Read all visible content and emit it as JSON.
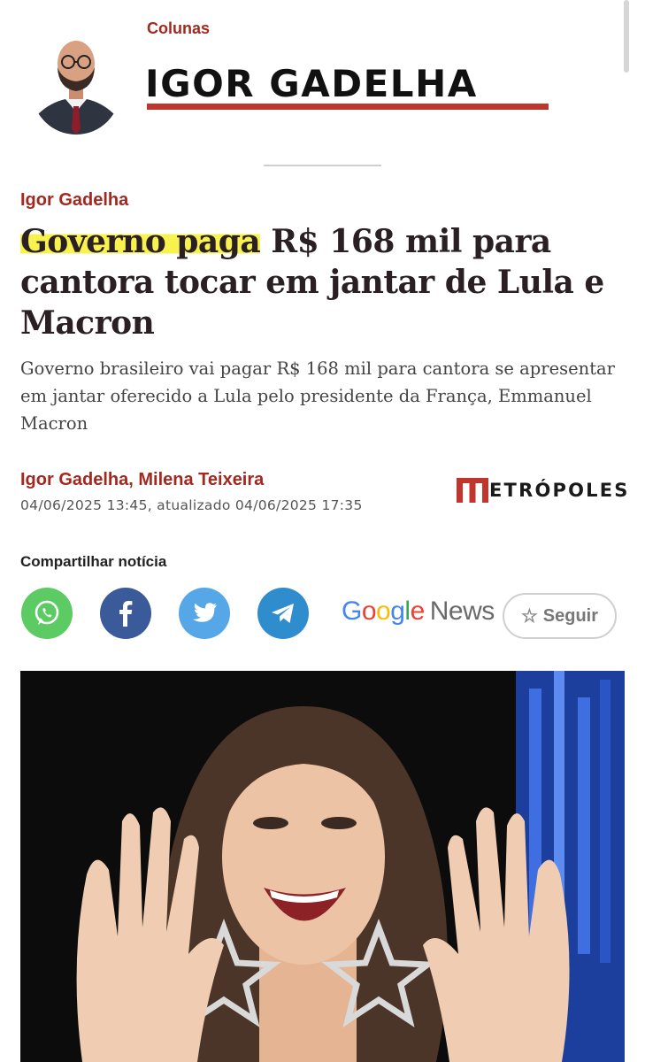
{
  "column": {
    "kicker": "Colunas",
    "name": "IGOR GADELHA"
  },
  "article": {
    "kicker": "Igor Gadelha",
    "headline_highlight": "Governo paga",
    "headline_rest": " R$ 168 mil para cantora tocar em jantar de Lula e Macron",
    "subtitle": "Governo brasileiro vai pagar R$ 168 mil para cantora se apresentar em jantar oferecido a Lula pelo presidente da França, Emmanuel Macron",
    "authors": "Igor Gadelha, Milena Teixeira",
    "dates": "04/06/2025 13:45, atualizado 04/06/2025 17:35",
    "brand": "ETRÓPOLES"
  },
  "share": {
    "title": "Compartilhar notícia",
    "buttons": [
      "whatsapp-icon",
      "facebook-icon",
      "twitter-icon",
      "telegram-icon"
    ]
  },
  "google_news": {
    "letters": [
      "G",
      "o",
      "o",
      "g",
      "l",
      "e"
    ],
    "news": "News",
    "follow_label": "Seguir"
  },
  "colors": {
    "accent": "#a3281f",
    "highlight": "#f7f24d",
    "whatsapp": "#5dcb63",
    "facebook": "#3b5a9a",
    "twitter": "#55a7e8",
    "telegram": "#2f8ccd"
  }
}
